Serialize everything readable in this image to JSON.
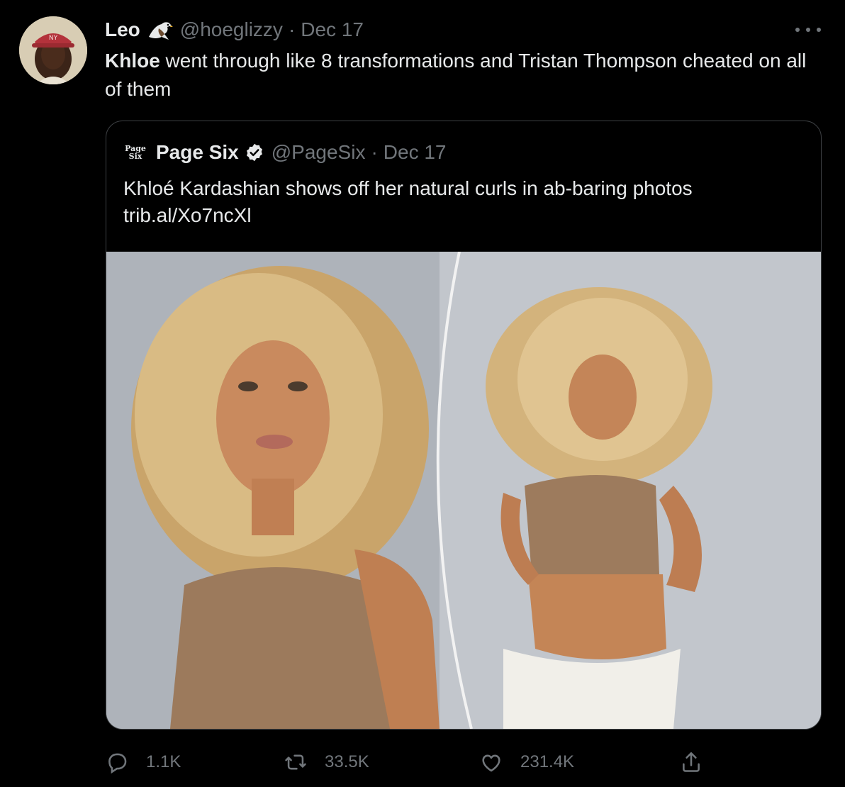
{
  "tweet": {
    "author_name": "Leo",
    "handle": "@hoeglizzy",
    "separator": "·",
    "date": "Dec 17",
    "text_bold": "Khloe",
    "text_rest": " went through like 8 transformations and Tristan Thompson cheated on all of them"
  },
  "quote": {
    "logo_line1": "Page",
    "logo_line2": "Six",
    "author_name": "Page Six",
    "handle": "@PageSix",
    "separator": "·",
    "date": "Dec 17",
    "headline": "Khloé Kardashian shows off her natural curls in ab-baring photos",
    "link": "trib.al/Xo7ncXl"
  },
  "actions": {
    "replies": "1.1K",
    "retweets": "33.5K",
    "likes": "231.4K"
  },
  "icons": [
    "eagle-icon",
    "more-icon",
    "verified-icon",
    "reply-icon",
    "retweet-icon",
    "like-icon",
    "share-icon"
  ],
  "colors": {
    "background": "#000000",
    "text": "#e7e9ea",
    "muted": "#71767b",
    "border": "#3e4144",
    "verified": "#e7e9ea"
  }
}
